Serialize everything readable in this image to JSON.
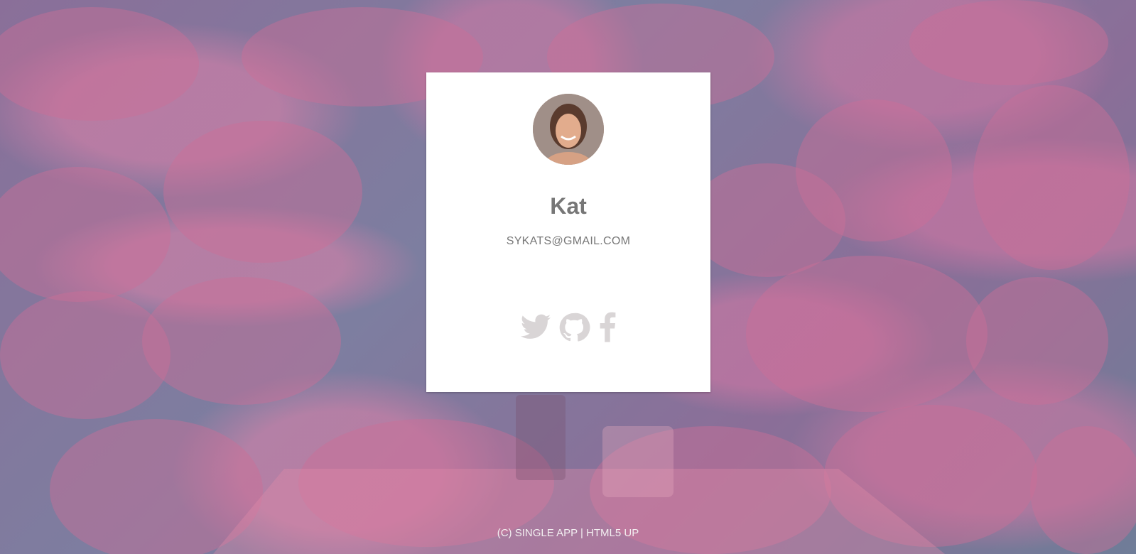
{
  "profile": {
    "name": "Kat",
    "email": "SYKATS@GMAIL.COM"
  },
  "social": [
    {
      "icon": "twitter-icon",
      "label": "Twitter"
    },
    {
      "icon": "github-icon",
      "label": "GitHub"
    },
    {
      "icon": "facebook-icon",
      "label": "Facebook"
    }
  ],
  "footer": {
    "copyright": "(C) SINGLE APP",
    "separator": " | ",
    "credit": "HTML5 UP"
  },
  "colors": {
    "card_bg": "#ffffff",
    "text": "#777777",
    "icon": "#d9d5d6"
  }
}
